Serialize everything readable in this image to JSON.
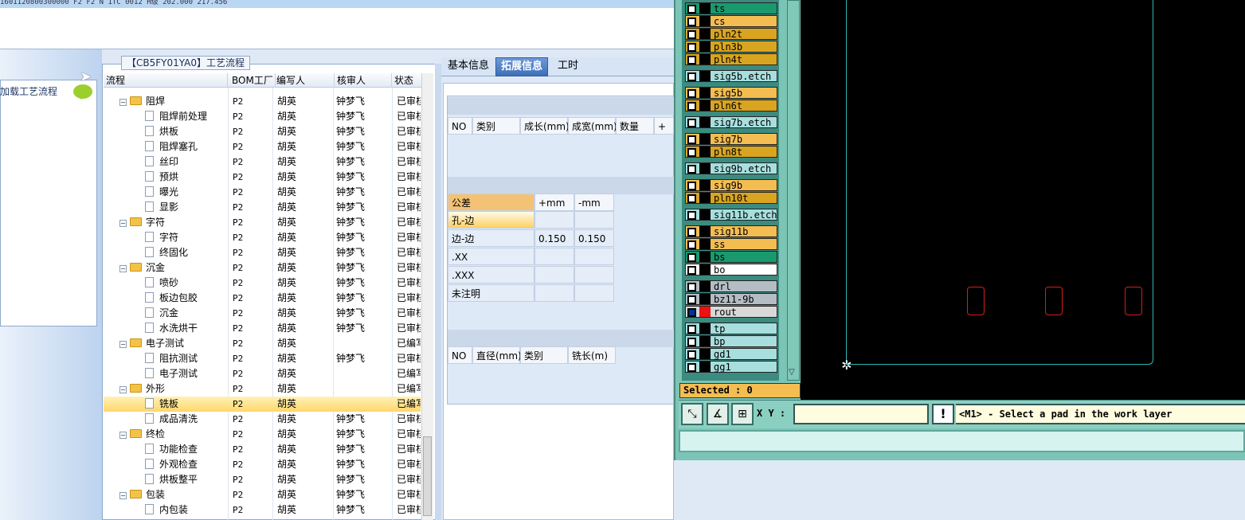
{
  "top_grid": {
    "row_text": "1601120800300000          F2          F2          N          1TC 0012 H级          202.000   217.456"
  },
  "left_panel": {
    "load_label": "加载工艺流程"
  },
  "tree": {
    "tab_title": "【CB5FY01YA0】工艺流程",
    "columns": [
      "流程",
      "BOM工厂",
      "编写人",
      "核审人",
      "状态"
    ],
    "rows": [
      {
        "indent": 1,
        "kind": "folder",
        "name": "阻焊",
        "bom": "P2",
        "writer": "胡英",
        "reviewer": "钟梦飞",
        "status": "已审核"
      },
      {
        "indent": 2,
        "kind": "doc",
        "name": "阻焊前处理",
        "bom": "P2",
        "writer": "胡英",
        "reviewer": "钟梦飞",
        "status": "已审核"
      },
      {
        "indent": 2,
        "kind": "doc",
        "name": "烘板",
        "bom": "P2",
        "writer": "胡英",
        "reviewer": "钟梦飞",
        "status": "已审核"
      },
      {
        "indent": 2,
        "kind": "doc",
        "name": "阻焊塞孔",
        "bom": "P2",
        "writer": "胡英",
        "reviewer": "钟梦飞",
        "status": "已审核"
      },
      {
        "indent": 2,
        "kind": "doc",
        "name": "丝印",
        "bom": "P2",
        "writer": "胡英",
        "reviewer": "钟梦飞",
        "status": "已审核"
      },
      {
        "indent": 2,
        "kind": "doc",
        "name": "预烘",
        "bom": "P2",
        "writer": "胡英",
        "reviewer": "钟梦飞",
        "status": "已审核"
      },
      {
        "indent": 2,
        "kind": "doc",
        "name": "曝光",
        "bom": "P2",
        "writer": "胡英",
        "reviewer": "钟梦飞",
        "status": "已审核"
      },
      {
        "indent": 2,
        "kind": "doc",
        "name": "显影",
        "bom": "P2",
        "writer": "胡英",
        "reviewer": "钟梦飞",
        "status": "已审核"
      },
      {
        "indent": 1,
        "kind": "folder",
        "name": "字符",
        "bom": "P2",
        "writer": "胡英",
        "reviewer": "钟梦飞",
        "status": "已审核"
      },
      {
        "indent": 2,
        "kind": "doc",
        "name": "字符",
        "bom": "P2",
        "writer": "胡英",
        "reviewer": "钟梦飞",
        "status": "已审核"
      },
      {
        "indent": 2,
        "kind": "doc",
        "name": "终固化",
        "bom": "P2",
        "writer": "胡英",
        "reviewer": "钟梦飞",
        "status": "已审核"
      },
      {
        "indent": 1,
        "kind": "folder",
        "name": "沉金",
        "bom": "P2",
        "writer": "胡英",
        "reviewer": "钟梦飞",
        "status": "已审核"
      },
      {
        "indent": 2,
        "kind": "doc",
        "name": "喷砂",
        "bom": "P2",
        "writer": "胡英",
        "reviewer": "钟梦飞",
        "status": "已审核"
      },
      {
        "indent": 2,
        "kind": "doc",
        "name": "板边包胶",
        "bom": "P2",
        "writer": "胡英",
        "reviewer": "钟梦飞",
        "status": "已审核"
      },
      {
        "indent": 2,
        "kind": "doc",
        "name": "沉金",
        "bom": "P2",
        "writer": "胡英",
        "reviewer": "钟梦飞",
        "status": "已审核"
      },
      {
        "indent": 2,
        "kind": "doc",
        "name": "水洗烘干",
        "bom": "P2",
        "writer": "胡英",
        "reviewer": "钟梦飞",
        "status": "已审核"
      },
      {
        "indent": 1,
        "kind": "folder",
        "name": "电子测试",
        "bom": "P2",
        "writer": "胡英",
        "reviewer": "",
        "status": "已编写"
      },
      {
        "indent": 2,
        "kind": "doc",
        "name": "阻抗测试",
        "bom": "P2",
        "writer": "胡英",
        "reviewer": "钟梦飞",
        "status": "已审核"
      },
      {
        "indent": 2,
        "kind": "doc",
        "name": "电子测试",
        "bom": "P2",
        "writer": "胡英",
        "reviewer": "",
        "status": "已编写"
      },
      {
        "indent": 1,
        "kind": "folder",
        "name": "外形",
        "bom": "P2",
        "writer": "胡英",
        "reviewer": "",
        "status": "已编写"
      },
      {
        "indent": 2,
        "kind": "doc",
        "name": "铣板",
        "bom": "P2",
        "writer": "胡英",
        "reviewer": "",
        "status": "已编写",
        "selected": true
      },
      {
        "indent": 2,
        "kind": "doc",
        "name": "成品清洗",
        "bom": "P2",
        "writer": "胡英",
        "reviewer": "钟梦飞",
        "status": "已审核"
      },
      {
        "indent": 1,
        "kind": "folder",
        "name": "终检",
        "bom": "P2",
        "writer": "胡英",
        "reviewer": "钟梦飞",
        "status": "已审核"
      },
      {
        "indent": 2,
        "kind": "doc",
        "name": "功能检查",
        "bom": "P2",
        "writer": "胡英",
        "reviewer": "钟梦飞",
        "status": "已审核"
      },
      {
        "indent": 2,
        "kind": "doc",
        "name": "外观检查",
        "bom": "P2",
        "writer": "胡英",
        "reviewer": "钟梦飞",
        "status": "已审核"
      },
      {
        "indent": 2,
        "kind": "doc",
        "name": "烘板整平",
        "bom": "P2",
        "writer": "胡英",
        "reviewer": "钟梦飞",
        "status": "已审核"
      },
      {
        "indent": 1,
        "kind": "folder",
        "name": "包装",
        "bom": "P2",
        "writer": "胡英",
        "reviewer": "钟梦飞",
        "status": "已审核"
      },
      {
        "indent": 2,
        "kind": "doc",
        "name": "内包装",
        "bom": "P2",
        "writer": "胡英",
        "reviewer": "钟梦飞",
        "status": "已审核"
      }
    ]
  },
  "mid": {
    "tabs": [
      "基本信息",
      "拓展信息",
      "工时"
    ],
    "active_tab": 1,
    "grid1_headers": [
      "NO",
      "类别",
      "成长(mm)",
      "成宽(mm)",
      "数量",
      "+"
    ],
    "tol_headers": [
      "公差",
      "+mm",
      "-mm"
    ],
    "tol_rows": [
      {
        "label": "孔-边",
        "plus": "",
        "minus": ""
      },
      {
        "label": "边-边",
        "plus": "0.150",
        "minus": "0.150"
      },
      {
        "label": ".XX",
        "plus": "",
        "minus": ""
      },
      {
        "label": ".XXX",
        "plus": "",
        "minus": ""
      },
      {
        "label": "未注明",
        "plus": "",
        "minus": ""
      }
    ],
    "grid3_headers": [
      "NO",
      "直径(mm)",
      "类别",
      "铣长(m)"
    ]
  },
  "cad": {
    "layers": [
      {
        "name": "ts",
        "color": "#1a9a6c"
      },
      {
        "name": "cs",
        "color": "#f3bd52"
      },
      {
        "name": "pln2t",
        "color": "#d9a520"
      },
      {
        "name": "pln3b",
        "color": "#d9a520"
      },
      {
        "name": "pln4t",
        "color": "#d9a520"
      },
      {
        "name": "sig5b.etch",
        "color": "#a8dede",
        "sep_before": true
      },
      {
        "name": "sig5b",
        "color": "#f3bd52",
        "sep_before": true
      },
      {
        "name": "pln6t",
        "color": "#d9a520"
      },
      {
        "name": "sig7b.etch",
        "color": "#a8dede",
        "sep_before": true
      },
      {
        "name": "sig7b",
        "color": "#f3bd52",
        "sep_before": true
      },
      {
        "name": "pln8t",
        "color": "#d9a520"
      },
      {
        "name": "sig9b.etch",
        "color": "#a8dede",
        "sep_before": true
      },
      {
        "name": "sig9b",
        "color": "#f3bd52",
        "sep_before": true
      },
      {
        "name": "pln10t",
        "color": "#d9a520"
      },
      {
        "name": "sig11b.etch",
        "color": "#a8dede",
        "sep_before": true
      },
      {
        "name": "sig11b",
        "color": "#f3bd52",
        "sep_before": true
      },
      {
        "name": "ss",
        "color": "#f3bd52"
      },
      {
        "name": "bs",
        "color": "#1a9a6c"
      },
      {
        "name": "bo",
        "color": "#ffffff"
      },
      {
        "name": "drl",
        "color": "#b4bcc4",
        "sep_before": true
      },
      {
        "name": "bz11-9b",
        "color": "#b4bcc4"
      },
      {
        "name": "rout",
        "color": "#d8d8d8",
        "active": true
      },
      {
        "name": "tp",
        "color": "#a8dede",
        "sep_before": true
      },
      {
        "name": "bp",
        "color": "#a8dede"
      },
      {
        "name": "gd1",
        "color": "#a8dede"
      },
      {
        "name": "gg1",
        "color": "#a8dede"
      }
    ],
    "selected_text": "Selected : 0",
    "xy_label": "X Y :",
    "xy_value": "",
    "prompt": "<M1> - Select a pad in the work layer"
  }
}
